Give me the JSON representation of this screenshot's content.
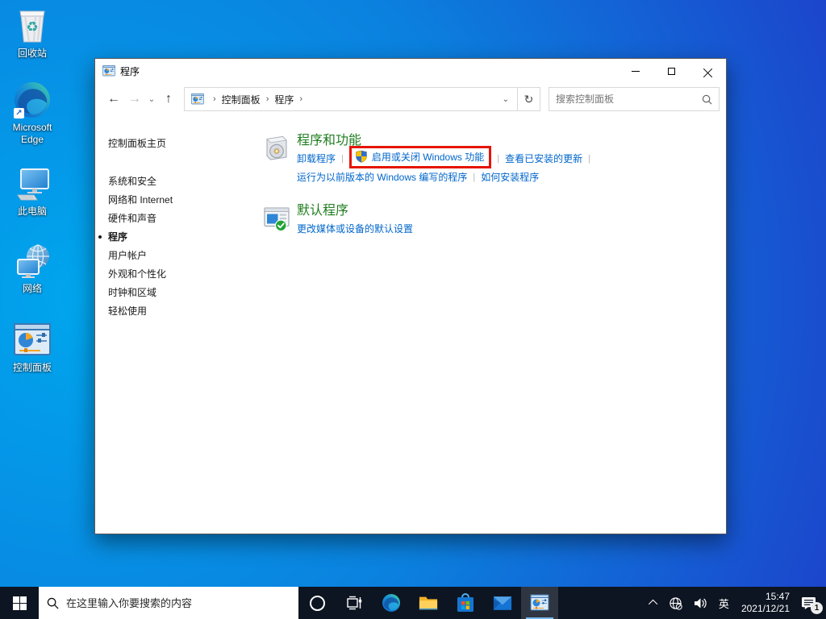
{
  "desktop": {
    "icons": [
      {
        "name": "recycle-bin",
        "label": "回收站"
      },
      {
        "name": "microsoft-edge",
        "label": "Microsoft Edge"
      },
      {
        "name": "this-pc",
        "label": "此电脑"
      },
      {
        "name": "network",
        "label": "网络"
      },
      {
        "name": "control-panel",
        "label": "控制面板"
      }
    ]
  },
  "window": {
    "title": "程序",
    "nav": {
      "back_icon": "←",
      "forward_icon": "→",
      "up_icon": "↑",
      "dropdown_icon": "⌄",
      "refresh_icon": "↻",
      "crumb_sep": "›"
    },
    "breadcrumb": [
      "控制面板",
      "程序"
    ],
    "search_placeholder": "搜索控制面板",
    "sidebar": {
      "home": "控制面板主页",
      "items": [
        {
          "label": "系统和安全"
        },
        {
          "label": "网络和 Internet"
        },
        {
          "label": "硬件和声音"
        },
        {
          "label": "程序",
          "active": true
        },
        {
          "label": "用户帐户"
        },
        {
          "label": "外观和个性化"
        },
        {
          "label": "时钟和区域"
        },
        {
          "label": "轻松使用"
        }
      ]
    },
    "sections": [
      {
        "title": "程序和功能",
        "links_row1": [
          "卸载程序",
          "启用或关闭 Windows 功能",
          "查看已安装的更新"
        ],
        "links_row2": [
          "运行为以前版本的 Windows 编写的程序",
          "如何安装程序"
        ]
      },
      {
        "title": "默认程序",
        "links": [
          "更改媒体或设备的默认设置"
        ]
      }
    ]
  },
  "taskbar": {
    "search_placeholder": "在这里输入你要搜索的内容",
    "language": "英",
    "time": "15:47",
    "date": "2021/12/21",
    "notification_count": "1"
  },
  "ui": {
    "divider": "|"
  },
  "colors": {
    "link_blue": "#0066cc",
    "heading_green": "#1e7d1e",
    "highlight_red": "#e51400",
    "taskbar_bg": "#0d1522",
    "desktop_blue_light": "#00a6ee",
    "desktop_blue_deep": "#1c44cc",
    "accent": "#0078d7"
  }
}
